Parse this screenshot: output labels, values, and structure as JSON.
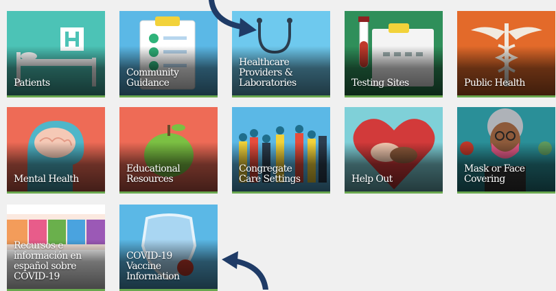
{
  "tiles": [
    {
      "label_lines": [
        "Patients"
      ],
      "icon": "hospital-bed-icon",
      "bg": "#4cc3b6"
    },
    {
      "label_lines": [
        "Community",
        "Guidance"
      ],
      "icon": "clipboard-checklist-icon",
      "bg": "#5bb8e6"
    },
    {
      "label_lines": [
        "Healthcare",
        "Providers &",
        "Laboratories"
      ],
      "icon": "stethoscope-icon",
      "bg": "#6ec9ee"
    },
    {
      "label_lines": [
        "Testing Sites"
      ],
      "icon": "test-tube-icon",
      "bg": "#2f8f5a"
    },
    {
      "label_lines": [
        "Public Health"
      ],
      "icon": "caduceus-icon",
      "bg": "#e36a2a"
    },
    {
      "label_lines": [
        "Mental Health"
      ],
      "icon": "brain-icon",
      "bg": "#ee6b56"
    },
    {
      "label_lines": [
        "Educational",
        "Resources"
      ],
      "icon": "apple-icon",
      "bg": "#ee6b56"
    },
    {
      "label_lines": [
        "Congregate",
        "Care Settings"
      ],
      "icon": "crowd-icon",
      "bg": "#5bb8e6"
    },
    {
      "label_lines": [
        "Help Out"
      ],
      "icon": "heart-hands-icon",
      "bg": "#7fd0d8"
    },
    {
      "label_lines": [
        "Mask or Face",
        "Covering"
      ],
      "icon": "masked-person-icon",
      "bg": "#2a8f98"
    },
    {
      "label_lines": [
        "Recursos e",
        "información en",
        "español sobre",
        "COVID-19"
      ],
      "icon": "espanol-banner-icon",
      "bg": "#ffffff"
    },
    {
      "label_lines": [
        "COVID-19",
        "Vaccine",
        "Information"
      ],
      "icon": "vaccine-shield-icon",
      "bg": "#5bb8e6"
    }
  ],
  "arrows": [
    {
      "icon": "curved-arrow-icon",
      "color": "#1f3b66"
    },
    {
      "icon": "curved-arrow-icon",
      "color": "#1f3b66"
    }
  ]
}
